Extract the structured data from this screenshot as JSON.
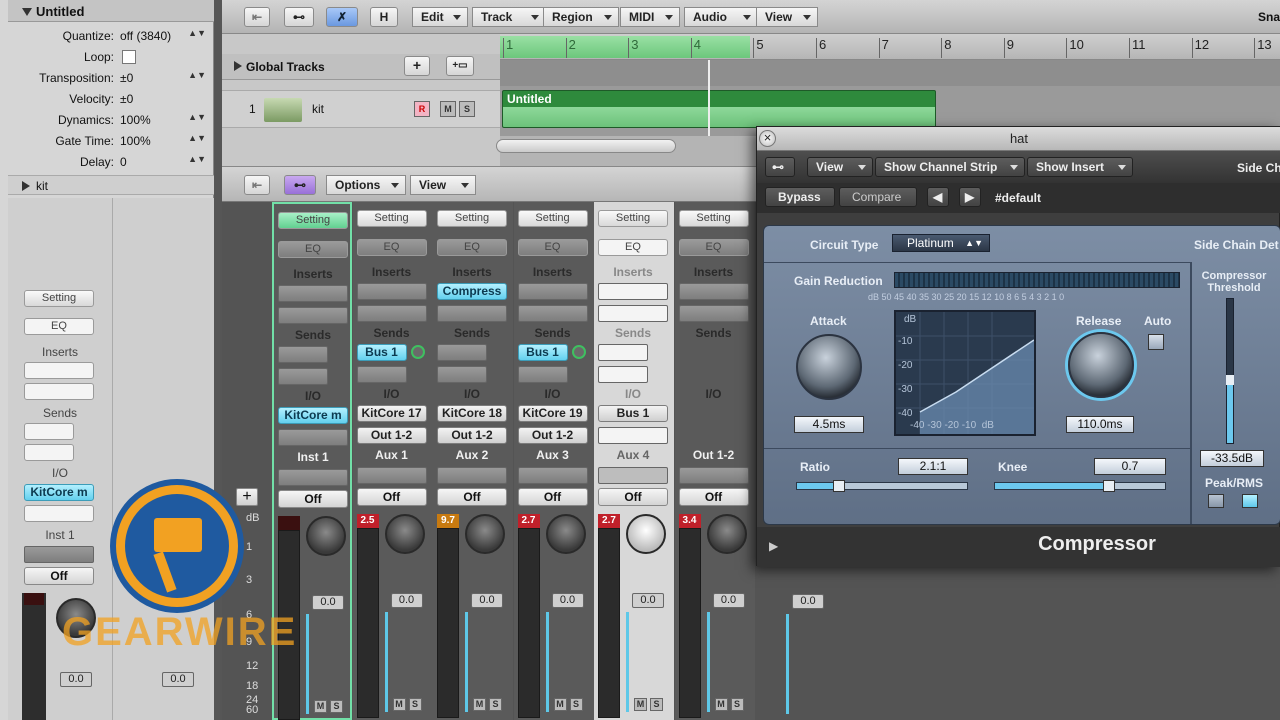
{
  "inspector": {
    "region_title": "Untitled",
    "params": [
      {
        "label": "Quantize:",
        "value": "off (3840)"
      },
      {
        "label": "Loop:",
        "value": ""
      },
      {
        "label": "Transposition:",
        "value": "±0"
      },
      {
        "label": "Velocity:",
        "value": "±0"
      },
      {
        "label": "Dynamics:",
        "value": "100%"
      },
      {
        "label": "Gate Time:",
        "value": "100%"
      },
      {
        "label": "Delay:",
        "value": "0"
      }
    ],
    "track_group": "kit",
    "strip": {
      "setting": "Setting",
      "eq": "EQ",
      "inserts": "Inserts",
      "sends": "Sends",
      "io": "I/O",
      "input": "KitCore m",
      "name": "Inst 1",
      "auto": "Off",
      "vol_a": "0.0",
      "vol_b": "0.0"
    }
  },
  "toolbar": {
    "h_button": "H",
    "menus": [
      "Edit",
      "Track",
      "Region",
      "MIDI",
      "Audio",
      "View"
    ],
    "snap": "Sna"
  },
  "tracks": {
    "global_tracks": "Global Tracks",
    "track_number": "1",
    "track_name": "kit",
    "rec": "R",
    "mute": "M",
    "solo": "S",
    "region_name": "Untitled"
  },
  "ruler": {
    "bars": [
      "1",
      "2",
      "3",
      "4",
      "5",
      "6",
      "7",
      "8",
      "9",
      "10",
      "11",
      "12",
      "13"
    ]
  },
  "mixer_bar": {
    "options": "Options",
    "view": "View"
  },
  "mixer": {
    "strip_labels": {
      "setting": "Setting",
      "eq": "EQ",
      "inserts": "Inserts",
      "sends": "Sends",
      "io": "I/O",
      "off": "Off"
    },
    "db_scale": [
      "dB",
      "1",
      "3",
      "6",
      "9",
      "12",
      "18",
      "24",
      "60"
    ],
    "channels": [
      {
        "name": "Inst 1",
        "insert": "",
        "send": "",
        "input": "KitCore m",
        "output": "",
        "peak": "",
        "volume": "0.0"
      },
      {
        "name": "Aux 1",
        "insert": "",
        "send": "Bus 1",
        "input": "KitCore 17",
        "output": "Out 1-2",
        "peak": "2.5",
        "volume": "0.0"
      },
      {
        "name": "Aux 2",
        "insert": "Compress",
        "send": "",
        "input": "KitCore 18",
        "output": "Out 1-2",
        "peak": "9.7",
        "volume": "0.0"
      },
      {
        "name": "Aux 3",
        "insert": "",
        "send": "Bus 1",
        "input": "KitCore 19",
        "output": "Out 1-2",
        "peak": "2.7",
        "volume": "0.0"
      },
      {
        "name": "Aux 4",
        "insert": "",
        "send": "",
        "input": "Bus 1",
        "output": "",
        "peak": "2.7",
        "volume": "0.0"
      },
      {
        "name": "Out 1-2",
        "insert": "",
        "send": "",
        "input": "",
        "output": "",
        "peak": "3.4",
        "volume": "0.0"
      }
    ],
    "extra_volume": "0.0"
  },
  "plugin": {
    "title": "hat",
    "view_menu": "View",
    "show_channel_strip": "Show Channel Strip",
    "show_insert": "Show Insert",
    "side_chain": "Side Ch",
    "bypass": "Bypass",
    "compare": "Compare",
    "preset": "#default",
    "circuit_type_label": "Circuit Type",
    "circuit_type": "Platinum",
    "side_chain_det": "Side Chain Det",
    "gain_reduction": "Gain Reduction",
    "gr_scale": "dB 50 45 40 35 30 25 20 15 12 10 8 6 5 4 3 2 1 0",
    "attack_label": "Attack",
    "attack_value": "4.5ms",
    "release_label": "Release",
    "release_value": "110.0ms",
    "auto_label": "Auto",
    "graph_y": [
      "dB",
      "-10",
      "-20",
      "-30",
      "-40"
    ],
    "graph_x": "-40 -30 -20 -10  dB",
    "threshold_label": "Compressor Threshold",
    "threshold_value": "-33.5dB",
    "peak_rms": "Peak/RMS",
    "ratio_label": "Ratio",
    "ratio_value": "2.1:1",
    "knee_label": "Knee",
    "knee_value": "0.7",
    "plugin_name": "Compressor"
  },
  "watermark": {
    "text": "GEARWIRE"
  }
}
